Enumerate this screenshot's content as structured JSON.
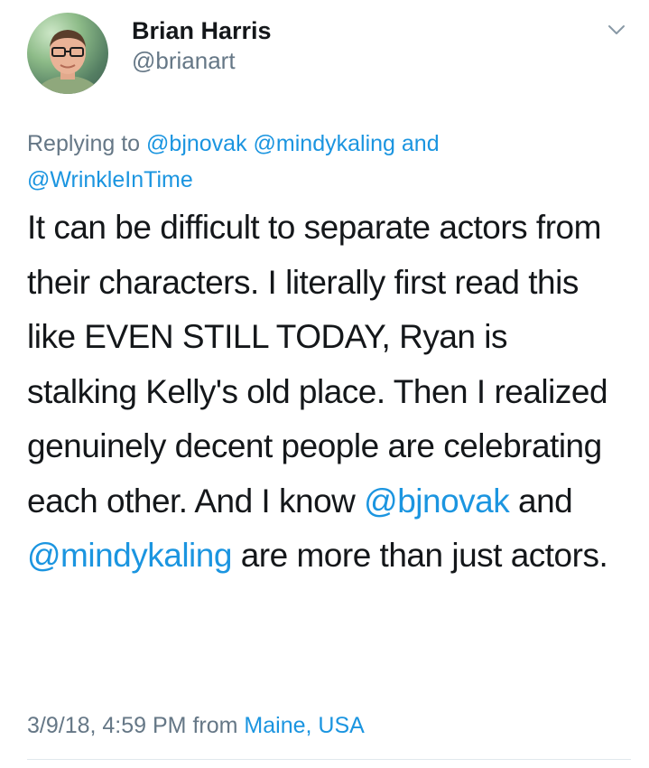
{
  "user": {
    "display_name": "Brian Harris",
    "handle": "@brianart",
    "avatar_icon": "profile-photo"
  },
  "reply": {
    "prefix": "Replying to",
    "mention1": "@bjnovak",
    "mention2": "@mindykaling",
    "and": "and",
    "mention3": "@WrinkleInTime"
  },
  "tweet": {
    "part1": "It can be difficult to separate actors from their characters. I literally first read this like EVEN STILL TODAY, Ryan is stalking Kelly's old place. Then I realized genuinely decent people are celebrating each other. And I know ",
    "mention1": "@bjnovak",
    "part2": " and ",
    "mention2": "@mindykaling",
    "part3": " are more than just actors."
  },
  "meta": {
    "timestamp": "3/9/18, 4:59 PM",
    "from": "from",
    "location": "Maine, USA"
  },
  "colors": {
    "link": "#1b95e0",
    "secondary_text": "#657786",
    "primary_text": "#14171a"
  }
}
